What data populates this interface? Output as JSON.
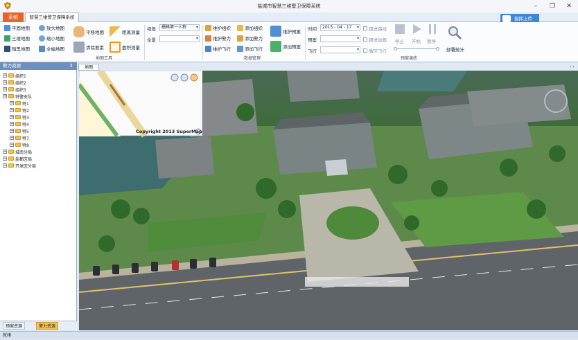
{
  "window": {
    "title": "盐城市智慧三维警卫保障系统",
    "controls": {
      "minimize": "–",
      "maximize": "❐",
      "close": "✕"
    }
  },
  "tabs": {
    "system": "系统",
    "main": "智慧三维警卫保障系统",
    "login": "指挥上传"
  },
  "ribbon": {
    "map_tools": {
      "group_label": "地图工具",
      "flat_map": "平面地图",
      "three_d_map": "三维地图",
      "night_map": "暗黑地图",
      "zoom_in": "放大地图",
      "zoom_out": "缩小地图",
      "full_map": "全幅地图",
      "pan_map": "平移地图",
      "clear_elements": "清除要素",
      "distance_measure": "距离测量",
      "area_measure": "面积测量"
    },
    "view": {
      "perspective_label": "视角",
      "perspective_value": "栅格第一人称",
      "scene_label": "全景",
      "scene_value": ""
    },
    "data_manage": {
      "group_label": "数据管理",
      "maintain_group": "维护组织",
      "add_group": "添加组织",
      "maintain_force": "维护警力",
      "add_force": "添加警力",
      "maintain_flight": "维护飞行",
      "add_flight": "添加飞行",
      "maintain_plan": "维护预案",
      "add_plan": "添加预案"
    },
    "plan_demo": {
      "group_label": "预案演练",
      "time_label": "时间",
      "time_value": "2015 - 04 - 17",
      "plan_label": "预案",
      "plan_value": "",
      "flight_label": "飞行",
      "flight_value": "",
      "follow_route": "跟进路线",
      "follow_motion": "跟进动画",
      "loop_flight": "循环飞行",
      "stop": "停止",
      "start": "开始",
      "pause": "暂停",
      "deploy_stats": "部署统计"
    }
  },
  "left_panel": {
    "title": "警力资源",
    "tree": [
      {
        "label": "组织1",
        "level": 0
      },
      {
        "label": "组织2",
        "level": 0
      },
      {
        "label": "组织3",
        "level": 0
      },
      {
        "label": "特警支队",
        "level": 0
      },
      {
        "label": "特1",
        "level": 1
      },
      {
        "label": "特2",
        "level": 1
      },
      {
        "label": "特3",
        "level": 1
      },
      {
        "label": "特4",
        "level": 1
      },
      {
        "label": "特5",
        "level": 1
      },
      {
        "label": "特7",
        "level": 1
      },
      {
        "label": "特8",
        "level": 1
      },
      {
        "label": "城南分局",
        "level": 0
      },
      {
        "label": "盐都区局",
        "level": 0
      },
      {
        "label": "开发区分局",
        "level": 0
      }
    ],
    "bottom_tabs": {
      "plan_resources": "预案资源",
      "police_resources": "警力资源"
    }
  },
  "map": {
    "tab_label": "地图",
    "minimap_copyright": "Copyright 2013 SuperMap"
  },
  "status": {
    "text": "就绪"
  },
  "colors": {
    "accent": "#e8622a",
    "brand_blue": "#3f86d8",
    "panel_head": "#6d8fbd"
  }
}
